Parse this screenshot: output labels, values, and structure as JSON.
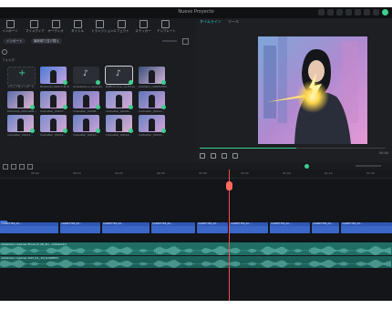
{
  "app": {
    "title": "Nuevo Proyecto"
  },
  "toolbar": {
    "items": [
      "インポート",
      "マイメディア",
      "オーディオ",
      "タイトル",
      "トランジション",
      "エフェクト",
      "ステッカー",
      "テンプレート"
    ]
  },
  "media": {
    "import_label": "インポート",
    "filter_label": "最新順で並び替え",
    "folder_label": "フォルダ",
    "import_media_label": "メディアをインポート",
    "items": [
      {
        "name": "Nintendo-Switch-M-2024-04-..."
      },
      {
        "name": "Ahdebidulco_GuGUsec..."
      },
      {
        "name": "ReMiXoTina--Gr-Ed-Aarl..."
      },
      {
        "name": "stuthijoo_C0M4S003..."
      },
      {
        "name": "Darkstrip_0001&NE..."
      },
      {
        "name": "Carbetter_00007..."
      },
      {
        "name": "Carbetter_00008..."
      },
      {
        "name": "Carbetter_00009..."
      },
      {
        "name": "Carbetter_00010..."
      },
      {
        "name": "Carbetter_00011..."
      },
      {
        "name": "Carbetter_00012..."
      },
      {
        "name": "Carbetter_00013..."
      },
      {
        "name": "Carbetter_00014..."
      },
      {
        "name": "Carbetter_00015..."
      }
    ]
  },
  "preview": {
    "tabs": [
      "タイムライン",
      "ツール"
    ],
    "time": "00:00"
  },
  "timeline": {
    "ruler_ticks": [
      "00:00",
      "00:10",
      "00:20",
      "00:30",
      "00:40",
      "00:50",
      "01:00",
      "01:10",
      "01:20",
      "01:30"
    ],
    "clip_label": "CARBETTER_00...",
    "audio_tracks": [
      {
        "label": "Ahdebidulco GuGUsec Ehrnie 01 (00_6h)   —Ahdebidulco"
      },
      {
        "label": "Ahdebidulco GuGUsec 2024 (01_-19)   SLOWBEAT"
      }
    ]
  },
  "colors": {
    "accent": "#3ecf8e",
    "clip": "#2f58b5",
    "audio": "#1f6e66",
    "playhead": "#ff4b4b"
  }
}
